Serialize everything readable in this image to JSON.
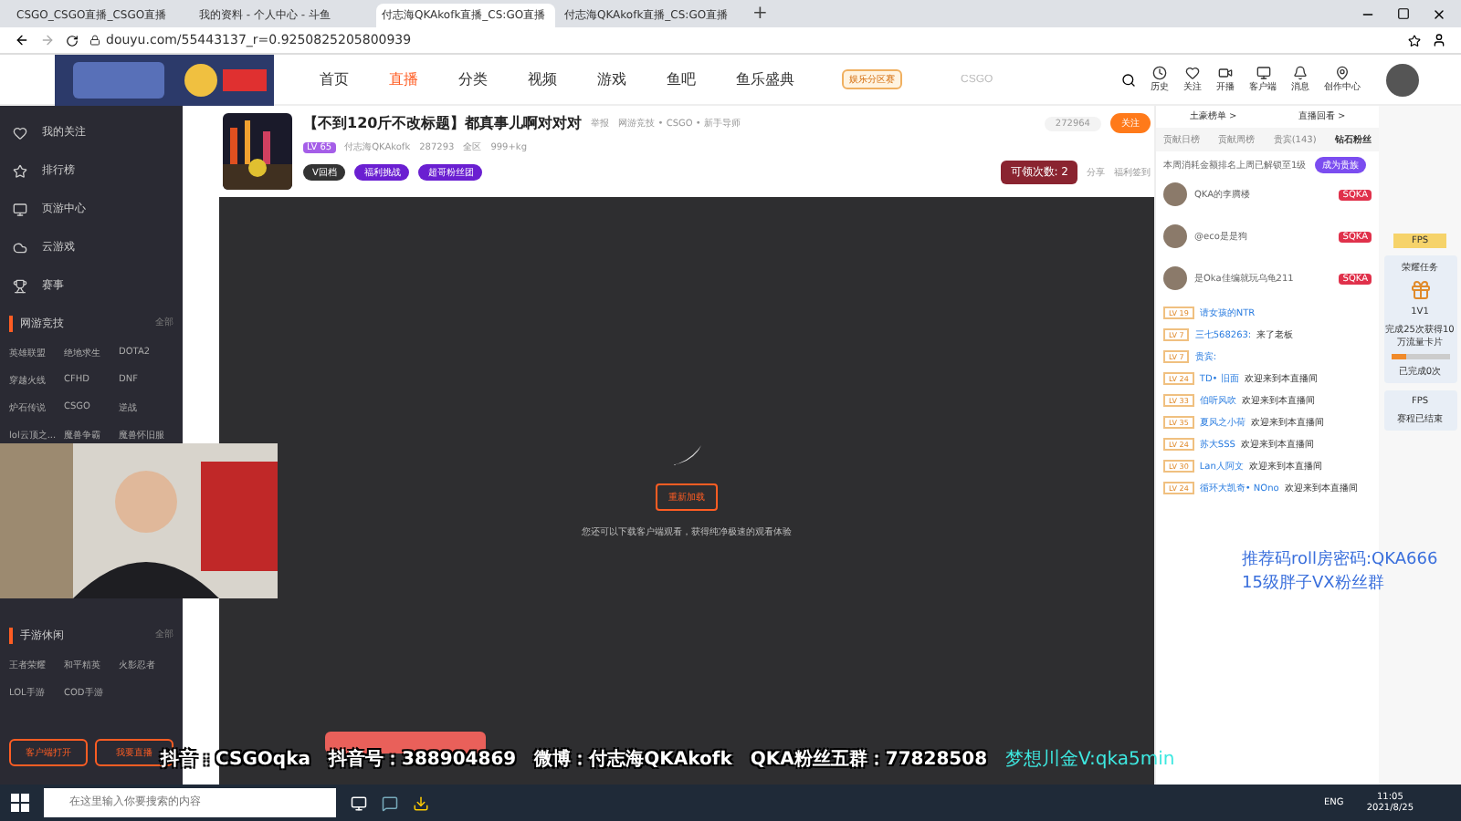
{
  "browser": {
    "tabs": [
      {
        "label": "CSGO_CSGO直播_CSGO直播",
        "selected": false
      },
      {
        "label": "我的资料 - 个人中心 - 斗鱼",
        "selected": false
      },
      {
        "label": "付志海QKAkofk直播_CS:GO直播",
        "selected": true
      },
      {
        "label": "付志海QKAkofk直播_CS:GO直播",
        "selected": false
      }
    ],
    "new_tab": "+",
    "url": "douyu.com/55443137_r=0.9250825205800939"
  },
  "site_nav": {
    "items": [
      {
        "label": "首页",
        "selected": false
      },
      {
        "label": "直播",
        "selected": true
      },
      {
        "label": "分类",
        "selected": false
      },
      {
        "label": "视频",
        "selected": false
      },
      {
        "label": "游戏",
        "selected": false
      },
      {
        "label": "鱼吧",
        "selected": false
      },
      {
        "label": "鱼乐盛典",
        "selected": false
      }
    ],
    "event_badge": "娱乐分区赛",
    "search": {
      "placeholder": "CSGO"
    },
    "tools": [
      "历史",
      "关注",
      "开播",
      "客户端",
      "消息",
      "创作中心"
    ]
  },
  "sidebar": {
    "items": [
      "我的关注",
      "排行榜",
      "页游中心",
      "云游戏",
      "赛事"
    ],
    "sections": [
      {
        "title": "网游竞技",
        "more": "全部",
        "games": [
          "英雄联盟",
          "绝地求生",
          "DOTA2",
          "穿越火线",
          "CFHD",
          "DNF",
          "炉石传说",
          "CSGO",
          "逆战",
          "lol云顶之...",
          "魔兽争霸",
          "魔兽怀旧服"
        ]
      },
      {
        "title": "手游休闲",
        "more": "全部",
        "games": [
          "王者荣耀",
          "和平精英",
          "火影忍者",
          "LOL手游",
          "COD手游"
        ]
      }
    ],
    "buttons": [
      "客户端打开",
      "我要直播"
    ]
  },
  "stream": {
    "title": "【不到120斤不改标题】都真事儿啊对对对",
    "report": "举报",
    "category": "网游竞技 • CSGO • 新手导师",
    "level": "LV 65",
    "anchor": "付志海QKAkofk",
    "heat": "287293",
    "region": "全区",
    "weight": "999+kg",
    "tags": [
      "V回档",
      "福利挑战",
      "超哥粉丝团"
    ],
    "followers": "272964",
    "follow": "关注",
    "claim": "可领次数: 2",
    "share": "分享",
    "checkin": "福利签到",
    "reload": "重新加载",
    "hint": "您还可以下载客户端观看，获得纯净极速的观看体验"
  },
  "ranking": {
    "links": [
      "土豪榜单 >",
      "直播回看 >"
    ],
    "tabs": [
      {
        "label": "贡献日榜",
        "selected": false
      },
      {
        "label": "贡献周榜",
        "selected": false
      },
      {
        "label": "贵宾(143)",
        "selected": false
      },
      {
        "label": "钻石粉丝",
        "selected": true
      }
    ],
    "notice": "本周消耗金额排名上周已解锁至1级",
    "join": "成为贵族",
    "rows": [
      {
        "name": "QKA的李腾楼",
        "badge": "SQKA"
      },
      {
        "name": "@eco是是狗",
        "badge": "SQKA"
      },
      {
        "name": "是Oka佳编就玩乌龟211",
        "badge": "SQKA"
      }
    ]
  },
  "chat": [
    {
      "level": "LV 19",
      "name": "请女孩的NTR"
    },
    {
      "level": "LV 7",
      "name": "三七568263:",
      "text": "来了老板"
    },
    {
      "level": "LV 7",
      "name": "贵宾:"
    },
    {
      "level": "LV 24",
      "name": "TD• 旧面",
      "text": "欢迎来到本直播间"
    },
    {
      "level": "LV 33",
      "name": "伯听风吹",
      "text": "欢迎来到本直播间"
    },
    {
      "level": "LV 35",
      "name": "夏风之小荷",
      "text": "欢迎来到本直播间"
    },
    {
      "level": "LV 24",
      "name": "苏大SSS",
      "text": "欢迎来到本直播间"
    },
    {
      "level": "LV 30",
      "name": "Lan人阿文",
      "text": "欢迎来到本直播间"
    },
    {
      "level": "LV 24",
      "name": "循环大凯奇• NOno",
      "text": "欢迎来到本直播间"
    }
  ],
  "promo": {
    "label": "FPS",
    "task": "荣耀任务",
    "badge": "1V1",
    "reward": "完成25次获得10万流量卡片",
    "level": 0.25,
    "progress": "已完成0次",
    "ended_title": "FPS",
    "ended": "赛程已结束"
  },
  "overlay": {
    "lines": [
      "推荐码roll房密码:QKA666",
      "15级胖子VX粉丝群"
    ],
    "socials": [
      "抖音：CSGOqka",
      "抖音号：388904869",
      "微博：付志海QKAkofk",
      "QKA粉丝五群：77828508"
    ],
    "slogan": "梦想川金V:qka5min"
  },
  "taskbar": {
    "search": {
      "placeholder": "在这里输入你要搜索的内容"
    },
    "lang": "ENG",
    "time": "11:05",
    "date": "2021/8/25"
  }
}
